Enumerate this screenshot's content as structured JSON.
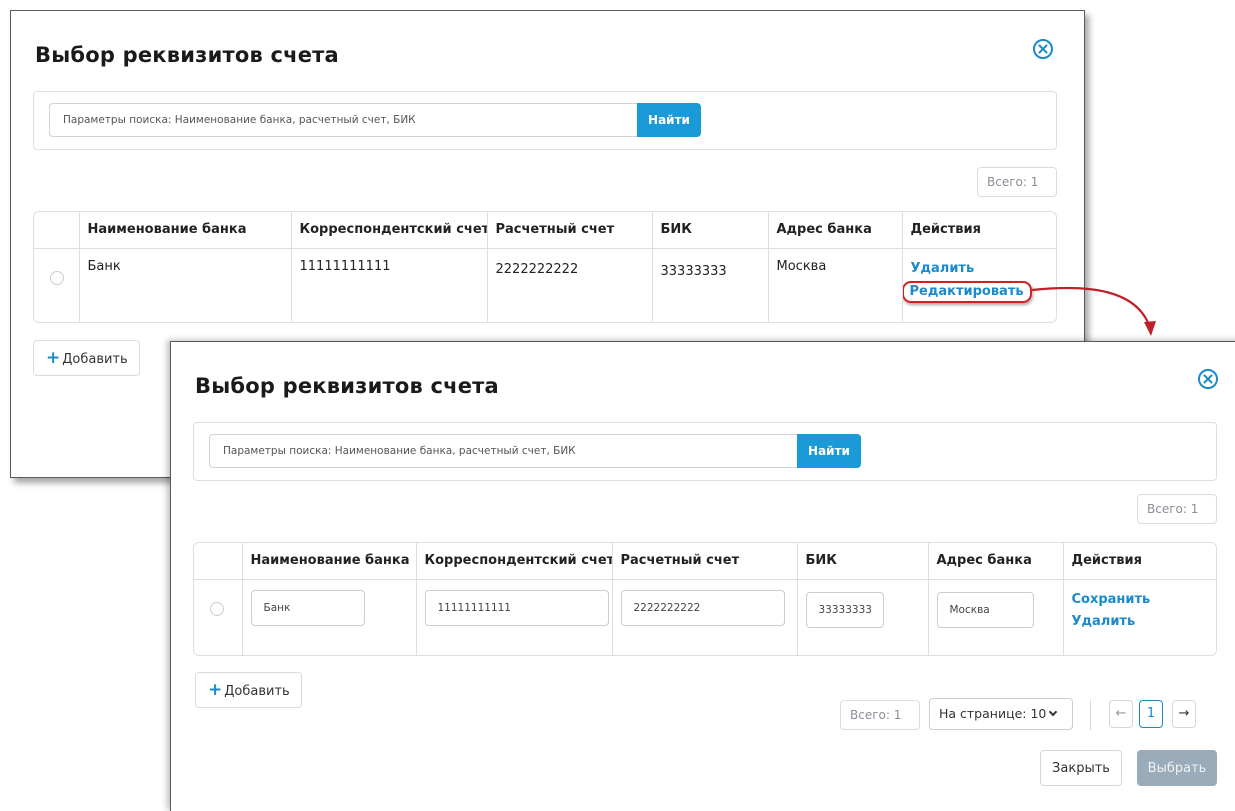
{
  "dialog": {
    "title": "Выбор реквизитов счета",
    "search_placeholder": "Параметры поиска: Наименование банка, расчетный счет, БИК",
    "search_button": "Найти",
    "total": "Всего: 1",
    "columns": [
      "Наименование банка",
      "Корреспондентский счет",
      "Расчетный счет",
      "БИК",
      "Адрес банка",
      "Действия"
    ],
    "row": {
      "bank_name": "Банк",
      "corr_account": "11111111111",
      "account": "2222222222",
      "bik": "33333333",
      "address": "Москва"
    },
    "actions_view": {
      "delete": "Удалить",
      "edit": "Редактировать"
    },
    "actions_edit": {
      "save": "Сохранить",
      "delete": "Удалить"
    },
    "add_button": "Добавить",
    "pager": {
      "total": "Всего: 1",
      "per_page": "На странице: 10",
      "prev": "←",
      "page": "1",
      "next": "→"
    },
    "close_button": "Закрыть",
    "select_button": "Выбрать"
  },
  "colors": {
    "accent": "#1a9ad6",
    "link": "#1a8ac8",
    "highlight": "#d42020",
    "disabled_button": "#9aabb9"
  },
  "icons": {
    "close": "circle-x-icon",
    "add": "plus-icon",
    "radio": "radio-unchecked-icon",
    "per_page": "chevron-down-icon",
    "annotation": "curved-arrow-icon"
  }
}
